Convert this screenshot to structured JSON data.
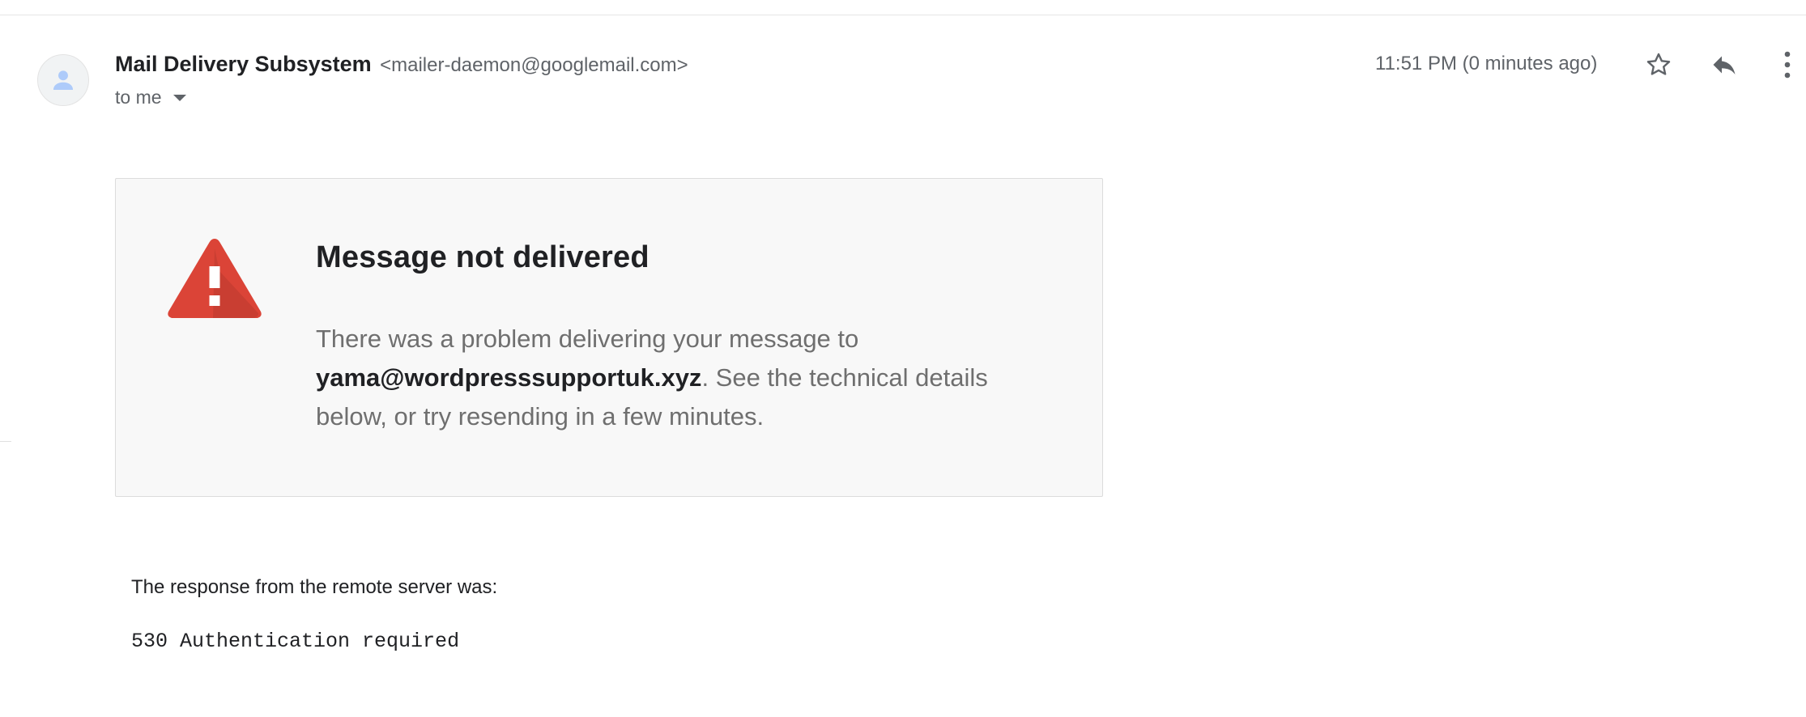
{
  "header": {
    "sender_name": "Mail Delivery Subsystem",
    "sender_email": "<mailer-daemon@googlemail.com>",
    "recipient": "to me",
    "timestamp": "11:51 PM (0 minutes ago)",
    "icons": {
      "avatar": "person-icon",
      "star": "star-icon",
      "reply": "reply-icon",
      "more": "more-vert-icon",
      "recipient_toggle": "caret-down-icon"
    }
  },
  "notice": {
    "icon": "warning-icon",
    "title": "Message not delivered",
    "body_before": "There was a problem delivering your message to ",
    "address": "yama@wordpresssupportuk.xyz",
    "body_after": ". See the technical details below, or try resending in a few minutes."
  },
  "response": {
    "label": "The response from the remote server was:",
    "code": "530 Authentication required"
  },
  "colors": {
    "warning_red": "#db4437",
    "card_background": "#f8f8f8",
    "avatar_background": "#f1f3f4",
    "avatar_person": "#aecbfa",
    "icon_gray": "#5f6368"
  }
}
